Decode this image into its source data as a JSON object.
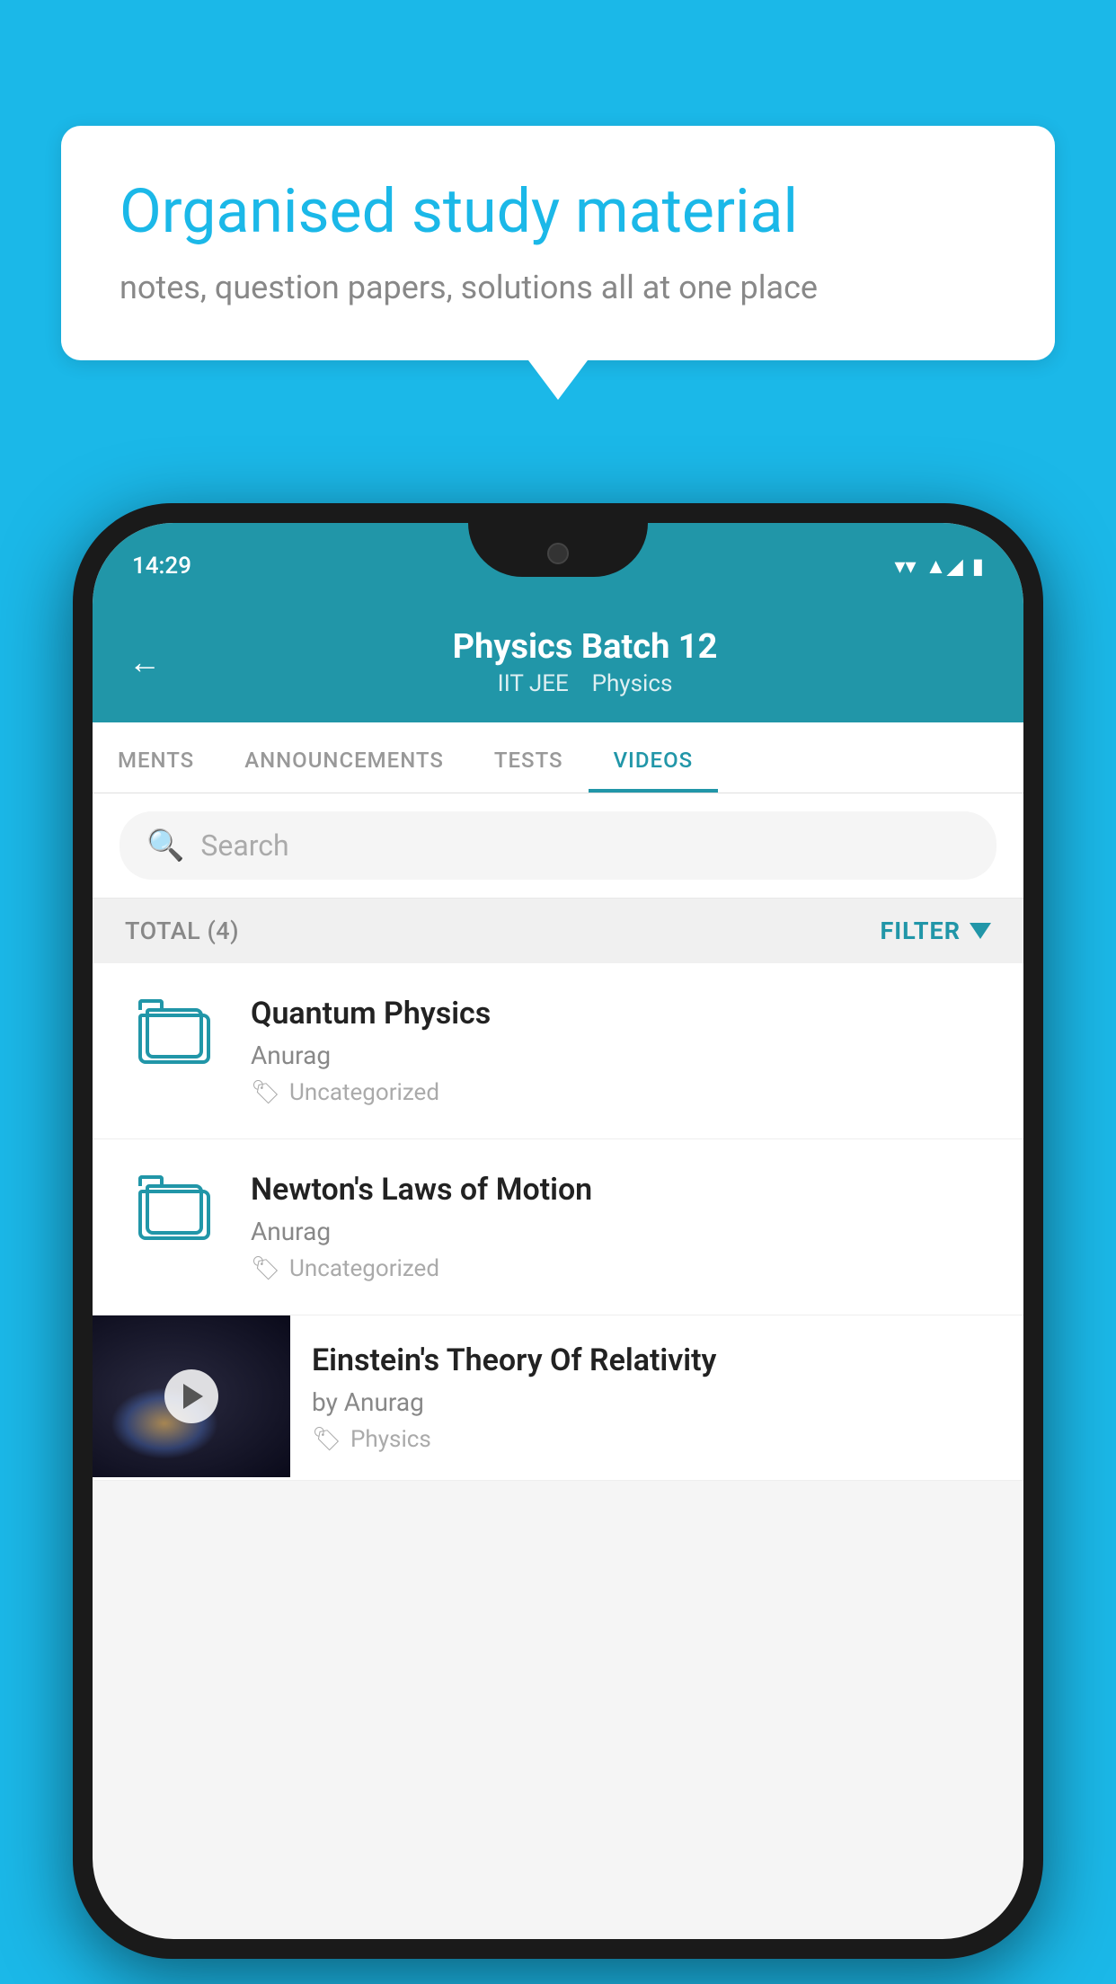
{
  "app": {
    "background_color": "#1bb8e8"
  },
  "speech_bubble": {
    "title": "Organised study material",
    "subtitle": "notes, question papers, solutions all at one place"
  },
  "status_bar": {
    "time": "14:29",
    "wifi": "▼",
    "signal": "▲",
    "battery": "▮"
  },
  "header": {
    "title": "Physics Batch 12",
    "subtitle_part1": "IIT JEE",
    "subtitle_part2": "Physics",
    "back_label": "←"
  },
  "tabs": [
    {
      "label": "MENTS",
      "active": false
    },
    {
      "label": "ANNOUNCEMENTS",
      "active": false
    },
    {
      "label": "TESTS",
      "active": false
    },
    {
      "label": "VIDEOS",
      "active": true
    }
  ],
  "search": {
    "placeholder": "Search"
  },
  "filter_bar": {
    "total_label": "TOTAL (4)",
    "filter_label": "FILTER"
  },
  "videos": [
    {
      "title": "Quantum Physics",
      "author": "Anurag",
      "tag": "Uncategorized",
      "has_thumbnail": false
    },
    {
      "title": "Newton's Laws of Motion",
      "author": "Anurag",
      "tag": "Uncategorized",
      "has_thumbnail": false
    },
    {
      "title": "Einstein's Theory Of Relativity",
      "author": "by Anurag",
      "tag": "Physics",
      "has_thumbnail": true
    }
  ]
}
